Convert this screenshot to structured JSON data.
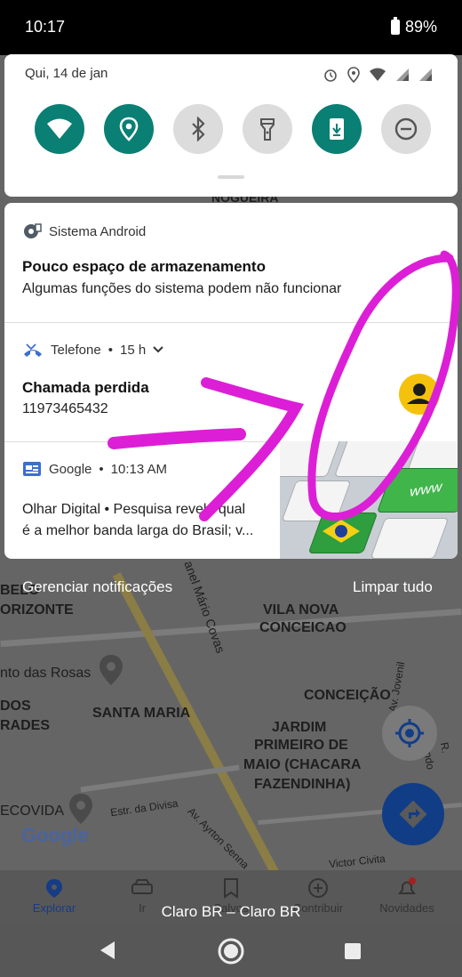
{
  "status_bar": {
    "time": "10:17",
    "battery": "89%"
  },
  "quick_settings": {
    "date": "Qui, 14 de jan",
    "tiles": [
      {
        "name": "wifi-icon",
        "on": true
      },
      {
        "name": "location-icon",
        "on": true
      },
      {
        "name": "bluetooth-icon",
        "on": false
      },
      {
        "name": "flashlight-icon",
        "on": false
      },
      {
        "name": "auto-rotate-icon",
        "on": true
      },
      {
        "name": "do-not-disturb-icon",
        "on": false
      }
    ]
  },
  "notifications": [
    {
      "app": "Sistema Android",
      "title": "Pouco espaço de armazenamento",
      "text": "Algumas funções do sistema podem não funcionar"
    },
    {
      "app": "Telefone",
      "time": "15 h",
      "title": "Chamada perdida",
      "text": "11973465432"
    },
    {
      "app": "Google",
      "time": "10:13 AM",
      "text_line1": "Olhar Digital • Pesquisa revela qual",
      "text_line2": "é a melhor banda larga do Brasil; v...",
      "thumb_label": "www"
    }
  ],
  "actions": {
    "manage": "Gerenciar notificações",
    "clear": "Limpar tudo"
  },
  "map": {
    "labels": [
      "NOGUEIRA",
      "BELO",
      "ORIZONTE",
      "VILA NOVA",
      "CONCEICAO",
      "nto das Rosas",
      "CONCEIÇÃO",
      "DOS",
      "RADES",
      "SANTA MARIA",
      "JARDIM",
      "PRIMEIRO DE",
      "MAIO (CHACARA",
      "FAZENDINHA)",
      "ECOVIDA",
      "Estr. da Divisa",
      "Av. Ayrton Senna",
      "Victor Civita",
      "Av. Jovenil",
      "R. Orlando",
      "anel Mário Covas",
      "Google"
    ]
  },
  "app_nav": {
    "items": [
      "Explorar",
      "Ir",
      "Salvos",
      "Contribuir",
      "Novidades"
    ]
  },
  "carrier": "Claro BR – Claro BR",
  "colors": {
    "teal": "#0a7f74",
    "marker": "#dc1fd6",
    "nav_blue": "#103d86"
  }
}
